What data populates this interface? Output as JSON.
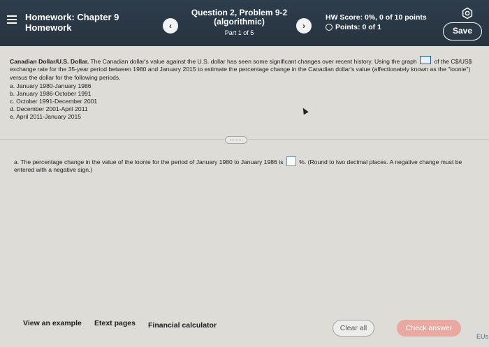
{
  "header": {
    "hw_title_line1": "Homework: Chapter 9",
    "hw_title_line2": "Homework",
    "question_title_line1": "Question 2, Problem 9-2",
    "question_title_line2": "(algorithmic)",
    "part_label": "Part 1 of 5",
    "hw_score": "HW Score: 0%, 0 of 10 points",
    "points": "Points: 0 of 1",
    "save_label": "Save",
    "prev_glyph": "‹",
    "next_glyph": "›"
  },
  "problem": {
    "title": "Canadian Dollar/U.S. Dollar.",
    "text_before_graph": "The Canadian dollar's value against the U.S. dollar has seen some significant changes over recent history. Using the graph",
    "text_after_graph": "of the C$/US$ exchange rate for the 35-year period between 1980 and January 2015 to estimate the percentage change in the Canadian dollar's value (affectionately known as the \"loonie\") versus the dollar for the following periods.",
    "parts": [
      "a. January 1980-January 1986",
      "b. January 1986-October 1991",
      "c. October 1991-December 2001",
      "d. December 2001-April 2011",
      "e. April 2011-January 2015"
    ]
  },
  "question": {
    "text_before_box": "a. The percentage change in the value of the loonie for the period of January 1980 to January 1986 is",
    "text_after_box": "%. (Round to two decimal places. A negative change must be entered with a negative sign.)"
  },
  "footer": {
    "view_example": "View an example",
    "etext_pages": "Etext pages",
    "financial_calculator": "Financial calculator",
    "clear_all": "Clear all",
    "check_answer": "Check answer",
    "corner_text": "EUs"
  },
  "colors": {
    "header_bg": "#2c3a48",
    "content_bg": "#dddcd6",
    "check_answer_bg": "#e9a9a0"
  },
  "icons": [
    "hamburger-menu-icon",
    "chevron-left-icon",
    "chevron-right-icon",
    "gear-icon",
    "graph-icon",
    "points-circle-icon"
  ]
}
